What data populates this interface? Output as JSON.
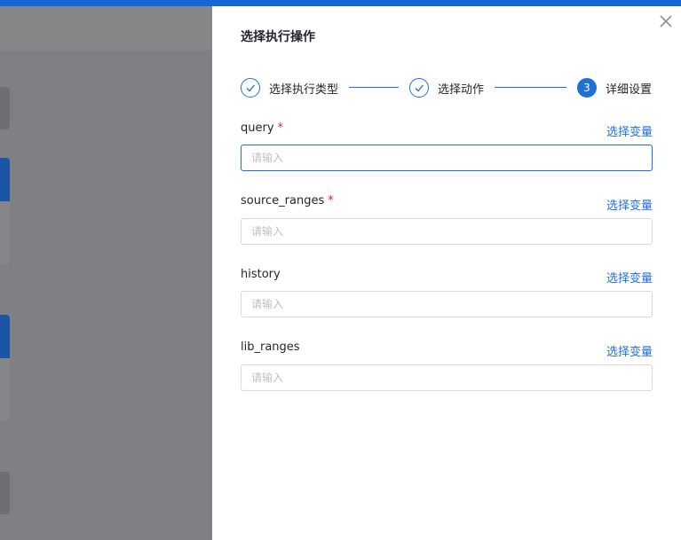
{
  "drawer": {
    "title": "选择执行操作"
  },
  "steps": [
    {
      "label": "选择执行类型",
      "status": "done",
      "icon": "check-icon"
    },
    {
      "label": "选择动作",
      "status": "done",
      "icon": "check-icon"
    },
    {
      "label": "详细设置",
      "status": "active",
      "number": "3"
    }
  ],
  "fields": [
    {
      "name": "query",
      "required": "*",
      "placeholder": "请输入",
      "link": "选择变量"
    },
    {
      "name": "source_ranges",
      "required": "*",
      "placeholder": "请输入",
      "link": "选择变量"
    },
    {
      "name": "history",
      "placeholder": "请输入",
      "link": "选择变量"
    },
    {
      "name": "lib_ranges",
      "placeholder": "请输入",
      "link": "选择变量"
    }
  ],
  "colors": {
    "accent": "#1f6fd8",
    "required": "#f5222d",
    "topbar": "#1565d8"
  }
}
